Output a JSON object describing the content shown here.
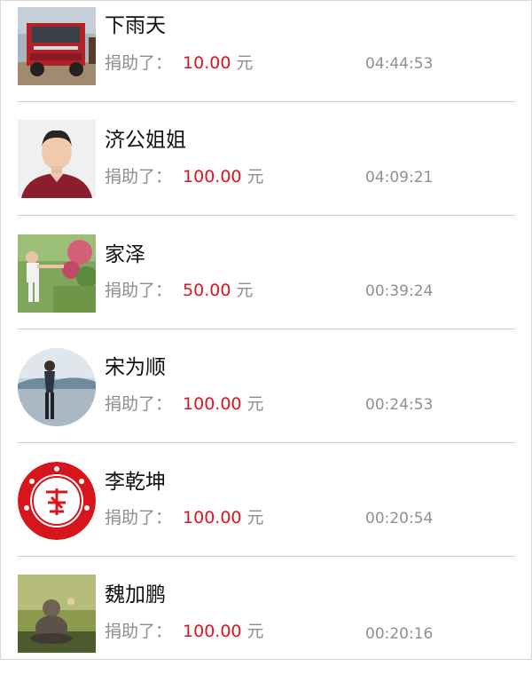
{
  "donations": [
    {
      "name": "下雨天",
      "label": "捐助了：",
      "amount": "10.00",
      "unit": "元",
      "time": "04:44:53",
      "avatar": "red-truck-photo"
    },
    {
      "name": "济公姐姐",
      "label": "捐助了：",
      "amount": "100.00",
      "unit": "元",
      "time": "04:09:21",
      "avatar": "woman-portrait-photo"
    },
    {
      "name": "家泽",
      "label": "捐助了：",
      "amount": "50.00",
      "unit": "元",
      "time": "00:39:24",
      "avatar": "child-in-garden-photo"
    },
    {
      "name": "宋为顺",
      "label": "捐助了：",
      "amount": "100.00",
      "unit": "元",
      "time": "00:24:53",
      "avatar": "person-by-water-photo"
    },
    {
      "name": "李乾坤",
      "label": "捐助了：",
      "amount": "100.00",
      "unit": "元",
      "time": "00:20:54",
      "avatar": "red-seal-logo"
    },
    {
      "name": "魏加鹏",
      "label": "捐助了：",
      "amount": "100.00",
      "unit": "元",
      "time": "00:20:16",
      "avatar": "buddha-statue-photo"
    }
  ],
  "colors": {
    "amount": "#e0141e",
    "secondary_text": "#8f8f8f",
    "name_text": "#111111",
    "divider": "#cfcfcf"
  }
}
